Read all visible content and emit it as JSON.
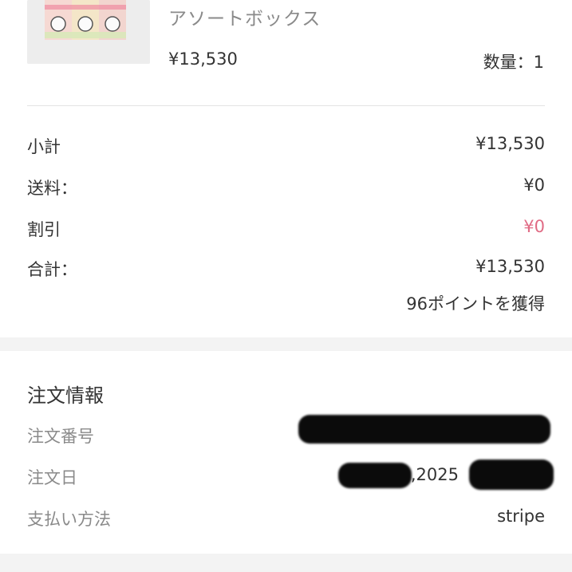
{
  "product": {
    "name": "アソートボックス",
    "price": "¥13,530",
    "quantity": "数量：1"
  },
  "summary": {
    "subtotal_label": "小計",
    "subtotal_value": "¥13,530",
    "shipping_label": "送料：",
    "shipping_value": "¥0",
    "discount_label": "割引",
    "discount_value": "¥0",
    "total_label": "合計：",
    "total_value": "¥13,530",
    "points": "96ポイントを獲得"
  },
  "order_info": {
    "title": "注文情報",
    "order_number_label": "注文番号",
    "order_date_label": "注文日",
    "order_date_visible": ",2025",
    "payment_method_label": "支払い方法",
    "payment_method_value": "stripe"
  },
  "colors": {
    "discount": "#e06a84",
    "muted_label": "#8a8a8a",
    "band": "#f3f3f3"
  }
}
